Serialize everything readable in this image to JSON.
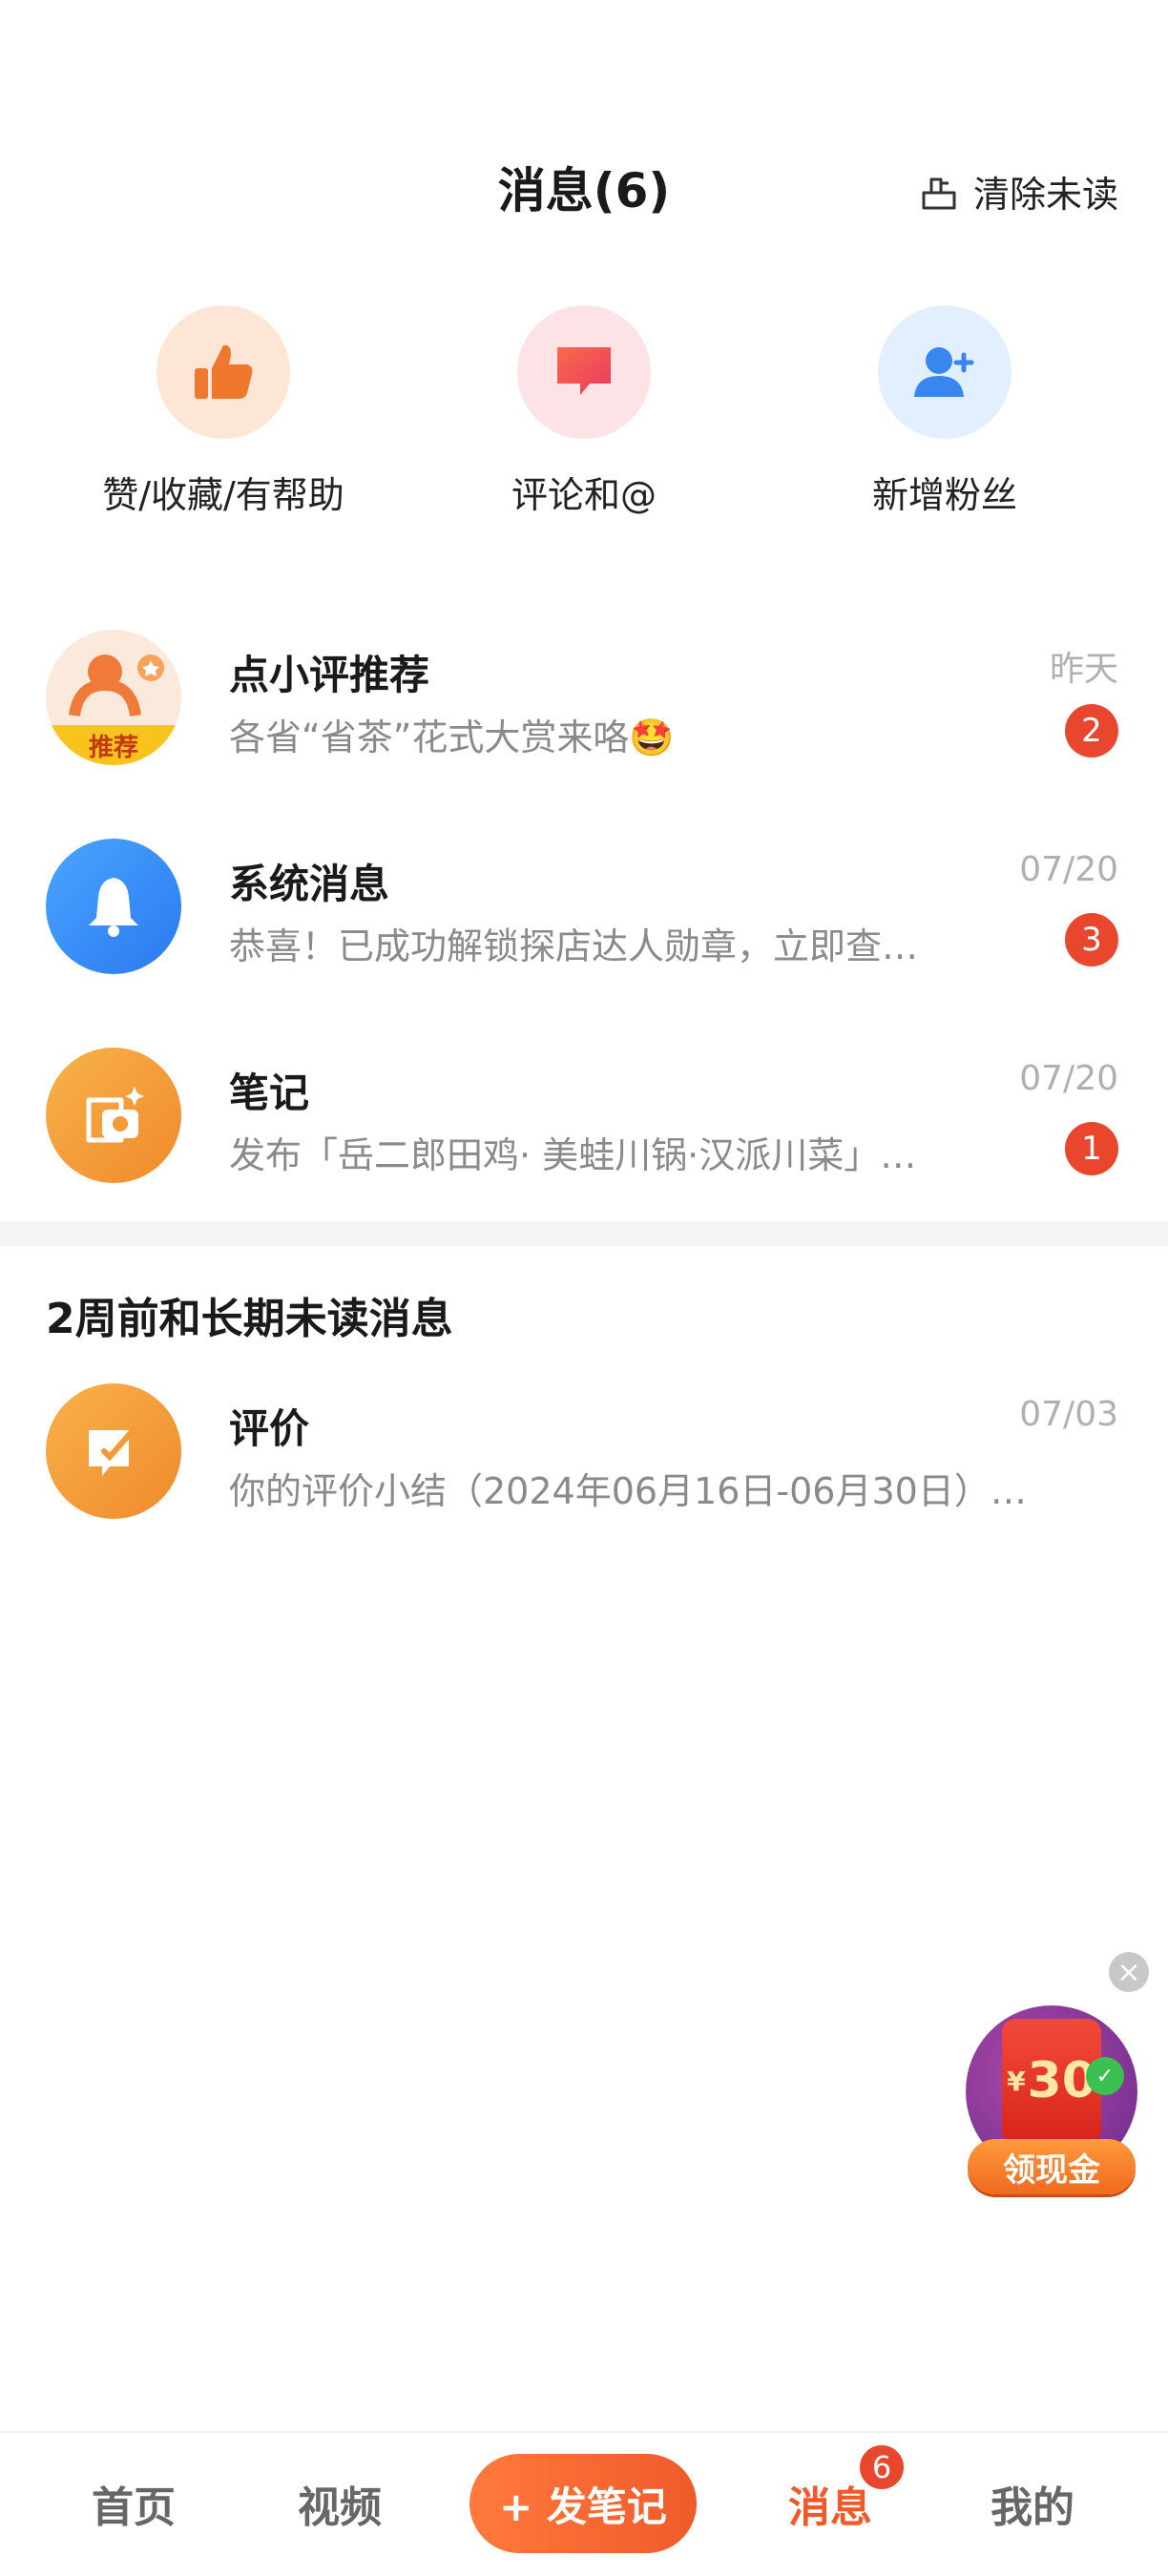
{
  "header": {
    "title": "消息(6)",
    "clear_unread": "清除未读"
  },
  "quick_actions": [
    {
      "label": "赞/收藏/有帮助",
      "icon": "thumbs-up-icon"
    },
    {
      "label": "评论和@",
      "icon": "comment-icon"
    },
    {
      "label": "新增粉丝",
      "icon": "add-user-icon"
    }
  ],
  "messages": [
    {
      "name": "点小评推荐",
      "time": "昨天",
      "preview": "各省“省茶”花式大赏来咯🤩",
      "badge": "2",
      "avatar_label": "推荐"
    },
    {
      "name": "系统消息",
      "time": "07/20",
      "preview": "恭喜！已成功解锁探店达人勋章，立即查…",
      "badge": "3"
    },
    {
      "name": "笔记",
      "time": "07/20",
      "preview": "发布「岳二郎田鸡· 美蛙川锅·汉派川菜」…",
      "badge": "1"
    }
  ],
  "section_title": "2周前和长期未读消息",
  "old_messages": [
    {
      "name": "评价",
      "time": "07/03",
      "preview": "你的评价小结（2024年06月16日-06月30日）…"
    }
  ],
  "promo": {
    "amount": "30",
    "currency": "¥",
    "label": "领现金"
  },
  "tabbar": {
    "home": "首页",
    "video": "视频",
    "post": "+ 发笔记",
    "messages": "消息",
    "messages_badge": "6",
    "mine": "我的"
  },
  "colors": {
    "accent": "#f05a2a",
    "badge": "#e8472e"
  }
}
